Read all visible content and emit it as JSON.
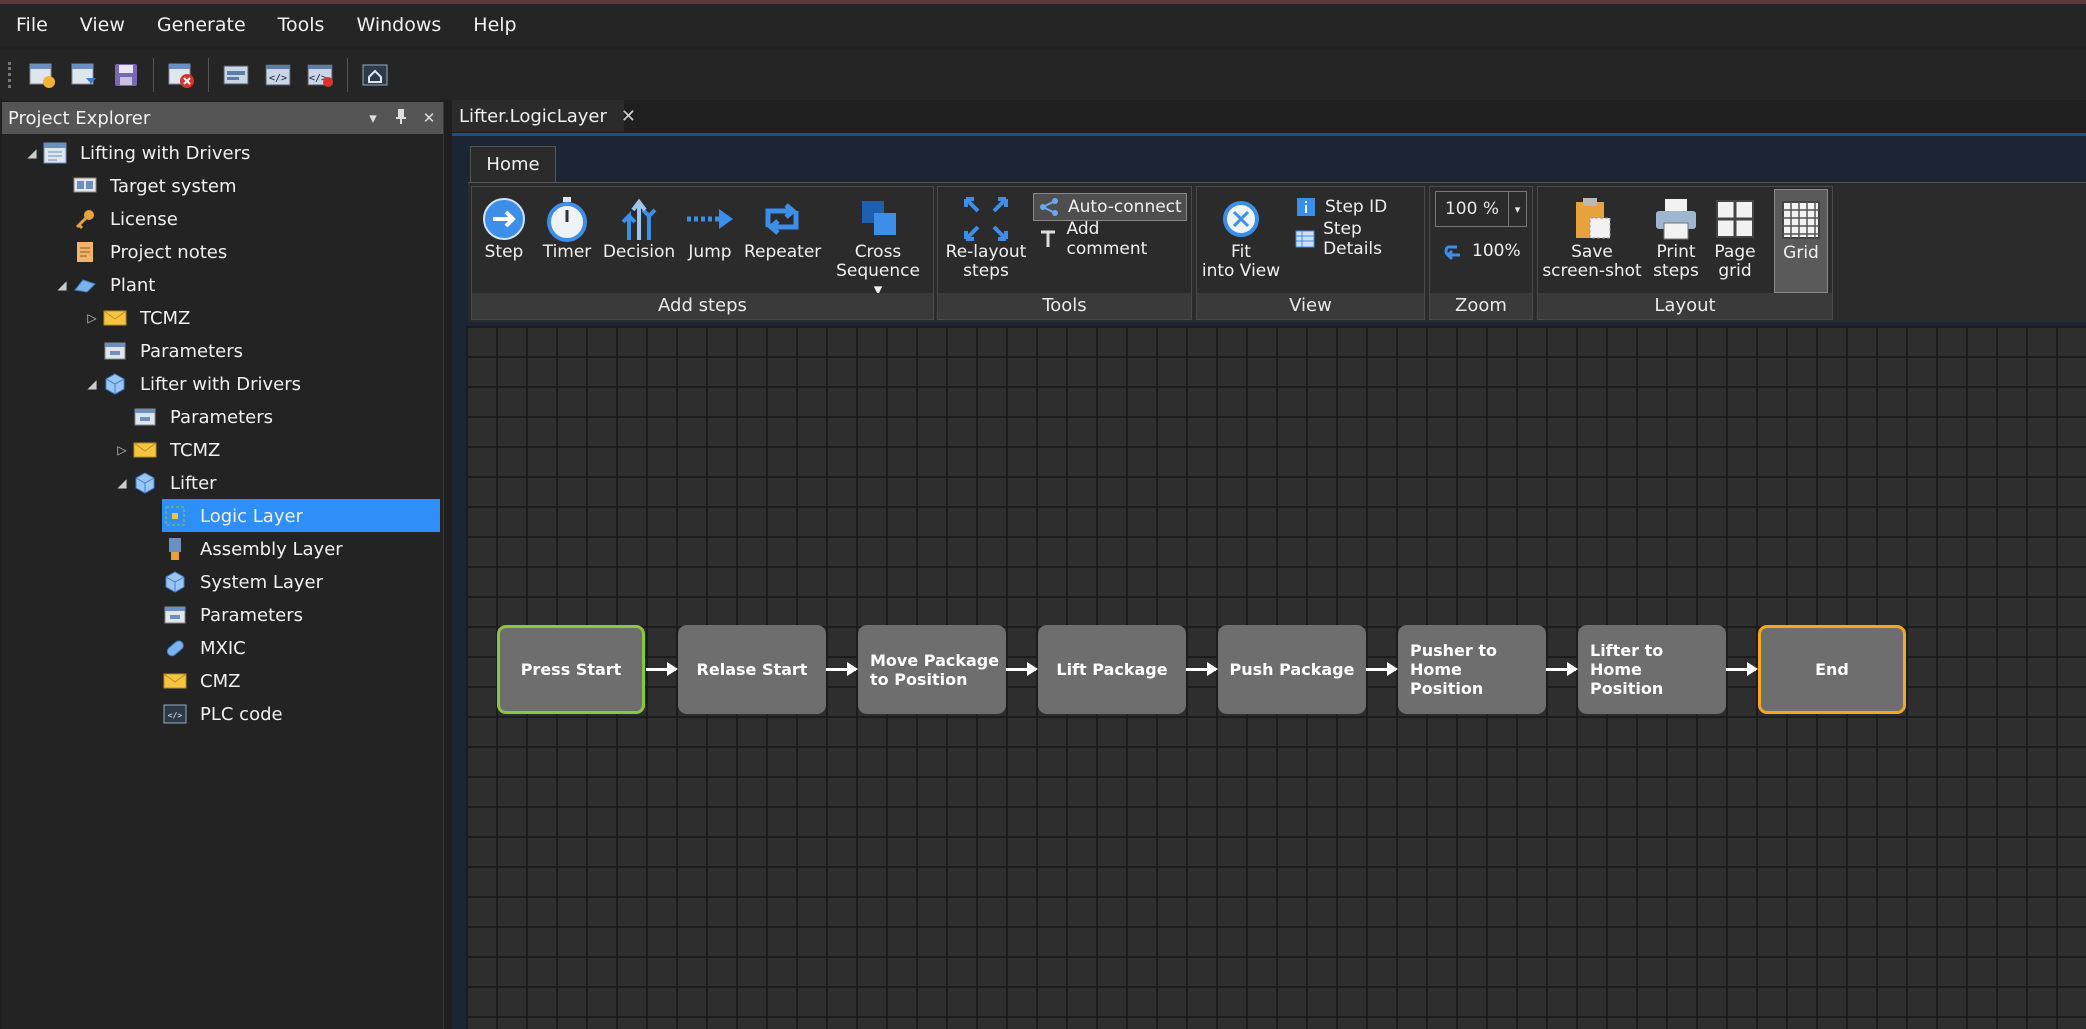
{
  "menu": [
    "File",
    "View",
    "Generate",
    "Tools",
    "Windows",
    "Help"
  ],
  "explorer": {
    "title": "Project Explorer",
    "controls": [
      "▾",
      "📌",
      "✕"
    ],
    "tree": [
      {
        "label": "Lifting with Drivers",
        "icon": "project-icon",
        "twisty": "◢"
      },
      {
        "label": "Target system",
        "icon": "target-system-icon",
        "twisty": ""
      },
      {
        "label": "License",
        "icon": "key-icon",
        "twisty": ""
      },
      {
        "label": "Project notes",
        "icon": "notes-icon",
        "twisty": ""
      },
      {
        "label": "Plant",
        "icon": "plant-icon",
        "twisty": "◢"
      },
      {
        "label": "TCMZ",
        "icon": "envelope-icon",
        "twisty": "▷"
      },
      {
        "label": "Parameters",
        "icon": "parameters-icon",
        "twisty": ""
      },
      {
        "label": "Lifter with Drivers",
        "icon": "cube-icon",
        "twisty": "◢"
      },
      {
        "label": "Parameters",
        "icon": "parameters-icon",
        "twisty": ""
      },
      {
        "label": "TCMZ",
        "icon": "envelope-icon",
        "twisty": "▷"
      },
      {
        "label": "Lifter",
        "icon": "cube-icon",
        "twisty": "◢"
      },
      {
        "label": "Logic Layer",
        "icon": "logic-layer-icon",
        "twisty": ""
      },
      {
        "label": "Assembly Layer",
        "icon": "assembly-layer-icon",
        "twisty": ""
      },
      {
        "label": "System Layer",
        "icon": "cube-icon",
        "twisty": ""
      },
      {
        "label": "Parameters",
        "icon": "parameters-icon",
        "twisty": ""
      },
      {
        "label": "MXIC",
        "icon": "pill-icon",
        "twisty": ""
      },
      {
        "label": "CMZ",
        "icon": "envelope-icon",
        "twisty": ""
      },
      {
        "label": "PLC code",
        "icon": "code-icon",
        "twisty": ""
      }
    ]
  },
  "doc_tab": {
    "label": "Lifter.LogicLayer",
    "close": "✕"
  },
  "ribbon": {
    "tab": "Home",
    "groups": {
      "add_steps": "Add steps",
      "tools": "Tools",
      "view": "View",
      "zoom": "Zoom",
      "layout": "Layout"
    },
    "buttons": {
      "step": "Step",
      "timer": "Timer",
      "decision": "Decision",
      "jump": "Jump",
      "repeater": "Repeater",
      "cross_sequence_1": "Cross",
      "cross_sequence_2": "Sequence ▾",
      "relayout_1": "Re-layout",
      "relayout_2": "steps",
      "auto_connect": "Auto-connect",
      "add_comment": "Add comment",
      "fit_1": "Fit",
      "fit_2": "into View",
      "step_id": "Step ID",
      "step_details": "Step Details",
      "zoom_value": "100 %",
      "zoom_reset": "100%",
      "save_1": "Save",
      "save_2": "screen-shot",
      "print_1": "Print",
      "print_2": "steps",
      "page_1": "Page",
      "page_2": "grid",
      "grid": "Grid"
    }
  },
  "steps": [
    "Press Start",
    "Relase Start",
    "Move Package to Position",
    "Lift Package",
    "Push Package",
    "Pusher to Home Position",
    "Lifter to Home Position",
    "End"
  ],
  "colors": {
    "accent": "#2f8ff8",
    "start_border": "#8cc63f",
    "end_border": "#f5a623",
    "step_fill": "#6e6e6e"
  }
}
